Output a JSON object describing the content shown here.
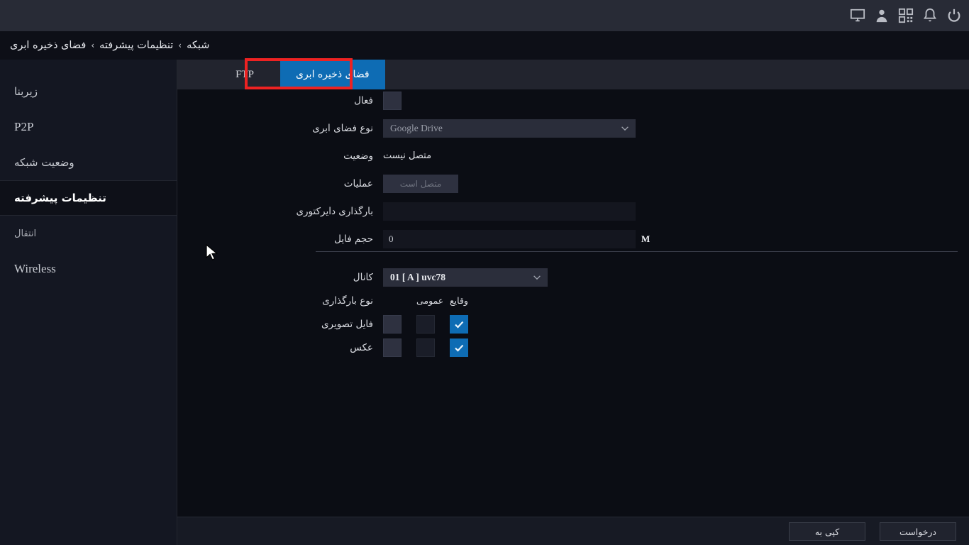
{
  "topbar": {
    "icons": [
      {
        "name": "monitor-icon",
        "label": "Monitor"
      },
      {
        "name": "user-icon",
        "label": "User"
      },
      {
        "name": "qrcode-icon",
        "label": "QR Code"
      },
      {
        "name": "bell-icon",
        "label": "Alarm"
      },
      {
        "name": "power-icon",
        "label": "Power"
      }
    ]
  },
  "breadcrumb": {
    "items": [
      "شبکه",
      "تنظیمات پیشرفته",
      "فضای ذخیره ابری"
    ],
    "separator": "›"
  },
  "sidebar": {
    "items": [
      {
        "label": "زیربنا",
        "selected": false,
        "latin": false
      },
      {
        "label": "P2P",
        "selected": false,
        "latin": true
      },
      {
        "label": "وضعیت شبکه",
        "selected": false,
        "latin": false
      },
      {
        "label": "تنظیمات پیشرفته",
        "selected": true,
        "latin": false
      },
      {
        "label": "انتقال",
        "selected": false,
        "latin": false
      },
      {
        "label": "Wireless",
        "selected": false,
        "latin": true
      }
    ]
  },
  "tabs": [
    {
      "label": "FTP",
      "active": false,
      "latin": true
    },
    {
      "label": "فضای ذخیره ابری",
      "active": true,
      "latin": false
    }
  ],
  "form": {
    "enable_label": "فعال",
    "enable_checked": false,
    "cloud_type_label": "نوع فضای ابری",
    "cloud_type_value": "Google Drive",
    "status_label": "وضعیت",
    "status_value": "متصل نیست",
    "operation_label": "عملیات",
    "operation_button": "متصل است",
    "upload_dir_label": "بارگذاری دایرکتوری",
    "upload_dir_value": "",
    "upload_dir_placeholder": "",
    "file_size_label": "حجم فایل",
    "file_size_value": "0",
    "file_size_unit": "M"
  },
  "matrix": {
    "channel_label": "کانال",
    "channel_value": "01 [ A ] uvc78",
    "upload_type_label": "نوع بارگذاری",
    "columns": [
      "وقایع",
      "عمومی",
      ""
    ],
    "rows": [
      {
        "label": "فایل تصویری",
        "checks": [
          true,
          false,
          false
        ]
      },
      {
        "label": "عکس",
        "checks": [
          true,
          false,
          false
        ]
      }
    ]
  },
  "footer": {
    "buttons": [
      {
        "label": "کپی به",
        "name": "copy-to-button"
      },
      {
        "label": "درخواست",
        "name": "apply-button"
      }
    ]
  },
  "colors": {
    "accent_blue": "#0e6cb4",
    "annotation_red": "#ee2222",
    "page_bg": "#0b0d14",
    "sidebar_bg": "#141722",
    "topbar_bg": "#282b36"
  }
}
